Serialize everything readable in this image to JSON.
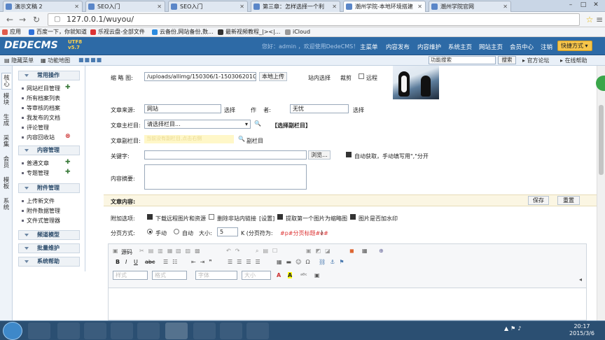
{
  "browser": {
    "tabs": [
      {
        "label": "演示文稿 2",
        "active": false
      },
      {
        "label": "SEO入门",
        "active": false
      },
      {
        "label": "SEO入门",
        "active": false
      },
      {
        "label": "第三章：怎样选择一个利",
        "active": false
      },
      {
        "label": "潮州学院-本地环境搭建",
        "active": true
      },
      {
        "label": "潮州学院官网",
        "active": false
      }
    ],
    "url": "127.0.0.1/wuyou/",
    "bookmarks": [
      "应用",
      "百度一下，你就知道",
      "乐视云盘-全部文件",
      "云备份,网站备份,数...",
      "最新视频教程_|><|...",
      "iCloud"
    ]
  },
  "cms": {
    "logo": "DEDECMS",
    "version_tag": "v5.7",
    "version_sub": "UTF8",
    "welcome": "您好：admin ，欢迎使用DedeCMS！",
    "top_nav": [
      "主菜单",
      "内容发布",
      "内容维护",
      "系统主页",
      "网站主页",
      "会员中心",
      "注销"
    ],
    "quick_menu": "快捷方式",
    "hide_menu": "隐藏菜单",
    "function_map": "功能地图",
    "search_placeholder": "功能搜索",
    "search_button": "搜索",
    "forum": "官方论坛",
    "online_help": "在线帮助"
  },
  "side_tabs": [
    "核心",
    "模块",
    "生成",
    "采集",
    "会员",
    "模板",
    "系统"
  ],
  "menu": {
    "sections": [
      {
        "title": "常用操作",
        "items": [
          "网站栏目管理",
          "所有档案列表",
          "等审核的档案",
          "我发布的文档",
          "评论管理",
          "内容回收站"
        ]
      },
      {
        "title": "内容管理",
        "items": [
          "普通文章",
          "专题管理"
        ]
      },
      {
        "title": "附件管理",
        "items": [
          "上传新文件",
          "附件数据管理",
          "文件式管理器"
        ]
      },
      {
        "title": "频道模型",
        "items": []
      },
      {
        "title": "批量维护",
        "items": []
      },
      {
        "title": "系统帮助",
        "items": []
      }
    ]
  },
  "form": {
    "thumbnail_label": "缩 略 图:",
    "thumbnail_value": "/uploads/allimg/150306/1-150306201G70-L",
    "local_upload": "本地上传",
    "site_select": "站内选择",
    "crop": "裁剪",
    "remote": "远程",
    "source_label": "文章来源:",
    "source_value": "网站",
    "select_btn": "选择",
    "author_label": "作    者:",
    "author_value": "无忧",
    "author_select": "选择",
    "main_column_label": "文章主栏目:",
    "main_column_value": "请选择栏目...",
    "choose_sub_column": "【选择副栏目】",
    "sub_column_label": "文章副栏目:",
    "sub_column_hint": "当前没有副栏目,点击右侧",
    "sub_column_btn": "副栏目",
    "keywords_label": "关键字:",
    "keywords_value": "",
    "browse": "浏览...",
    "auto_keywords": "自动获取，手动填写用\",\"分开",
    "summary_label": "内容摘要:",
    "content_label": "文章内容:",
    "save": "保存",
    "reset": "重置",
    "attach_label": "附加选项:",
    "opt_download_remote": "下载远程图片和资源",
    "opt_remove_links": "删除非站内链接",
    "opt_settings": "[设置]",
    "opt_first_image": "提取第一个图片为缩略图",
    "opt_watermark": "图片是否加水印",
    "paging_label": "分页方式:",
    "manual": "手动",
    "auto": "自动",
    "size_label": "大小:",
    "size_value": "5",
    "size_unit": "K (分页符为:",
    "page_break": "#p#分页标题#e#",
    "page_break_close": ")",
    "editor_source": "源码",
    "editor_style": "样式",
    "editor_format": "格式",
    "editor_font": "字体",
    "editor_size": "大小"
  },
  "taskbar": {
    "time": "20:17",
    "date": "2015/3/6"
  }
}
